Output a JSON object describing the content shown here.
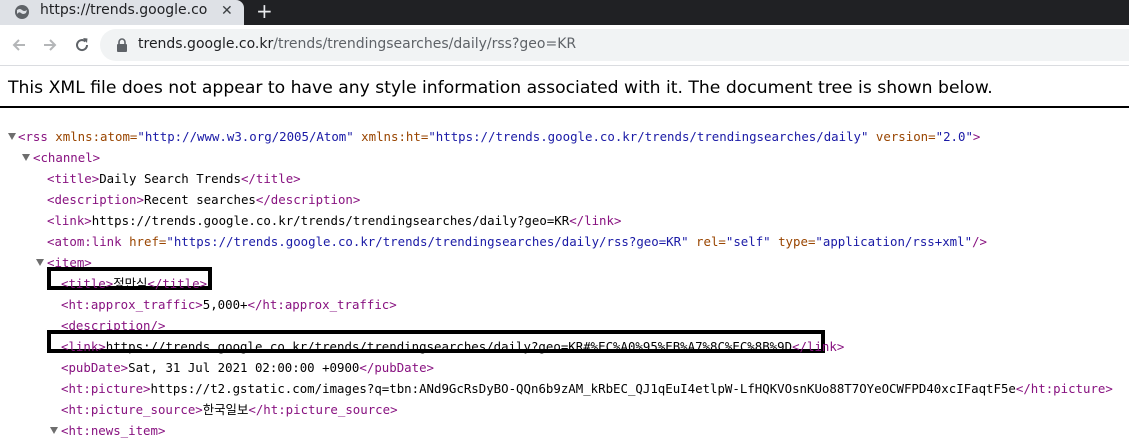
{
  "browser": {
    "tab_title": "https://trends.google.co",
    "tab_close": "✕",
    "new_tab": "+",
    "url_host": "trends.google.co.kr",
    "url_path": "/trends/trendingsearches/daily/rss?geo=KR"
  },
  "xml_notice": "This XML file does not appear to have any style information associated with it. The document tree is shown below.",
  "tree": {
    "rss": {
      "open": "<rss",
      "a1n": " xmlns:atom=",
      "a1v": "\"http://www.w3.org/2005/Atom\"",
      "a2n": " xmlns:ht=",
      "a2v": "\"https://trends.google.co.kr/trends/trendingsearches/daily\"",
      "a3n": " version=",
      "a3v": "\"2.0\"",
      "close": ">"
    },
    "channel": "<channel>",
    "title": {
      "open": "<title>",
      "text": "Daily Search Trends",
      "close": "</title>"
    },
    "description": {
      "open": "<description>",
      "text": "Recent searches",
      "close": "</description>"
    },
    "link": {
      "open": "<link>",
      "text": "https://trends.google.co.kr/trends/trendingsearches/daily?geo=KR",
      "close": "</link>"
    },
    "atom_link": {
      "open": "<atom:link",
      "a1n": " href=",
      "a1v": "\"https://trends.google.co.kr/trends/trendingsearches/daily/rss?geo=KR\"",
      "a2n": " rel=",
      "a2v": "\"self\"",
      "a3n": " type=",
      "a3v": "\"application/rss+xml\"",
      "close": "/>"
    },
    "item": "<item>",
    "item_title": {
      "open": "<title>",
      "text": "정만식",
      "close": "</title>"
    },
    "approx_traffic": {
      "open": "<ht:approx_traffic>",
      "text": "5,000+",
      "close": "</ht:approx_traffic>"
    },
    "item_description": "<description/>",
    "item_link": {
      "open": "<link>",
      "text": "https://trends.google.co.kr/trends/trendingsearches/daily?geo=KR#%EC%A0%95%EB%A7%8C%EC%8B%9D",
      "close": "</link>"
    },
    "pub_date": {
      "open": "<pubDate>",
      "text": "Sat, 31 Jul 2021 02:00:00 +0900",
      "close": "</pubDate>"
    },
    "picture": {
      "open": "<ht:picture>",
      "text": "https://t2.gstatic.com/images?q=tbn:ANd9GcRsDyBO-QQn6b9zAM_kRbEC_QJ1qEuI4etlpW-LfHQKVOsnKUo88T7OYeOCWFPD40xcIFaqtF5e",
      "close": "</ht:picture>"
    },
    "picture_source": {
      "open": "<ht:picture_source>",
      "text": "한국일보",
      "close": "</ht:picture_source>"
    },
    "news_item": "<ht:news_item>"
  }
}
